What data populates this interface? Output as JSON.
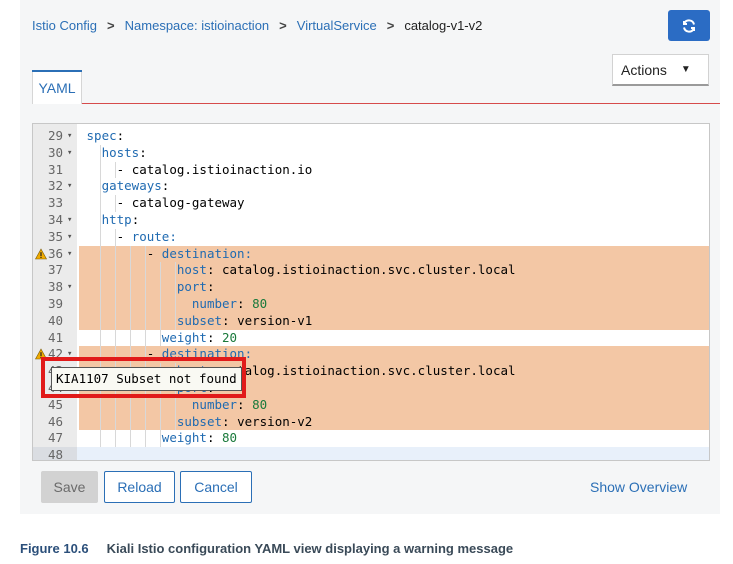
{
  "breadcrumb": {
    "items": [
      "Istio Config",
      "Namespace: istioinaction",
      "VirtualService"
    ],
    "current": "catalog-v1-v2",
    "separator": ">"
  },
  "toolbar": {
    "refresh_icon": "sync-icon",
    "actions_label": "Actions",
    "actions_icon": "caret-down-icon"
  },
  "tabs": [
    {
      "label": "YAML",
      "active": true
    }
  ],
  "editor": {
    "lines": [
      {
        "num": "29",
        "fold": true,
        "warn": false,
        "hl": false,
        "indent": 0,
        "key": "spec",
        "sep": ":",
        "val": "",
        "vtype": "str"
      },
      {
        "num": "30",
        "fold": true,
        "warn": false,
        "hl": false,
        "indent": 1,
        "key": "hosts",
        "sep": ":",
        "val": "",
        "vtype": "str"
      },
      {
        "num": "31",
        "fold": false,
        "warn": false,
        "hl": false,
        "indent": 2,
        "key": "",
        "sep": "- ",
        "val": "catalog.istioinaction.io",
        "vtype": "str"
      },
      {
        "num": "32",
        "fold": true,
        "warn": false,
        "hl": false,
        "indent": 1,
        "key": "gateways",
        "sep": ":",
        "val": "",
        "vtype": "str"
      },
      {
        "num": "33",
        "fold": false,
        "warn": false,
        "hl": false,
        "indent": 2,
        "key": "",
        "sep": "- ",
        "val": "catalog-gateway",
        "vtype": "str"
      },
      {
        "num": "34",
        "fold": true,
        "warn": false,
        "hl": false,
        "indent": 1,
        "key": "http",
        "sep": ":",
        "val": "",
        "vtype": "str"
      },
      {
        "num": "35",
        "fold": true,
        "warn": false,
        "hl": false,
        "indent": 2,
        "key": "",
        "sep": "- ",
        "val": "route:",
        "vtype": "key"
      },
      {
        "num": "36",
        "fold": true,
        "warn": true,
        "hl": true,
        "indent": 4,
        "key": "",
        "sep": "- ",
        "val": "destination:",
        "vtype": "key"
      },
      {
        "num": "37",
        "fold": false,
        "warn": false,
        "hl": true,
        "indent": 6,
        "key": "host",
        "sep": ": ",
        "val": "catalog.istioinaction.svc.cluster.local",
        "vtype": "str"
      },
      {
        "num": "38",
        "fold": true,
        "warn": false,
        "hl": true,
        "indent": 6,
        "key": "port",
        "sep": ":",
        "val": "",
        "vtype": "str"
      },
      {
        "num": "39",
        "fold": false,
        "warn": false,
        "hl": true,
        "indent": 7,
        "key": "number",
        "sep": ": ",
        "val": "80",
        "vtype": "num"
      },
      {
        "num": "40",
        "fold": false,
        "warn": false,
        "hl": true,
        "indent": 6,
        "key": "subset",
        "sep": ": ",
        "val": "version-v1",
        "vtype": "str"
      },
      {
        "num": "41",
        "fold": false,
        "warn": false,
        "hl": false,
        "indent": 5,
        "key": "weight",
        "sep": ": ",
        "val": "20",
        "vtype": "num"
      },
      {
        "num": "42",
        "fold": true,
        "warn": true,
        "hl": true,
        "indent": 4,
        "key": "",
        "sep": "- ",
        "val": "destination:",
        "vtype": "key"
      },
      {
        "num": "43",
        "fold": false,
        "warn": false,
        "hl": true,
        "indent": 6,
        "key": "host",
        "sep": ": ",
        "val": "catalog.istioinaction.svc.cluster.local",
        "vtype": "str"
      },
      {
        "num": "44",
        "fold": false,
        "warn": false,
        "hl": true,
        "indent": 6,
        "key": "port",
        "sep": ":",
        "val": "",
        "vtype": "str"
      },
      {
        "num": "45",
        "fold": false,
        "warn": false,
        "hl": true,
        "indent": 7,
        "key": "number",
        "sep": ": ",
        "val": "80",
        "vtype": "num"
      },
      {
        "num": "46",
        "fold": false,
        "warn": false,
        "hl": true,
        "indent": 6,
        "key": "subset",
        "sep": ": ",
        "val": "version-v2",
        "vtype": "str"
      },
      {
        "num": "47",
        "fold": false,
        "warn": false,
        "hl": false,
        "indent": 5,
        "key": "weight",
        "sep": ": ",
        "val": "80",
        "vtype": "num"
      },
      {
        "num": "48",
        "fold": false,
        "warn": false,
        "hl": false,
        "indent": 0,
        "key": "",
        "sep": "",
        "val": "",
        "vtype": "str",
        "active": true
      }
    ],
    "tooltip": "KIA1107 Subset not found",
    "warn_icon": "warning-triangle-icon",
    "fold_icon": "fold-caret-icon"
  },
  "buttons": {
    "save": "Save",
    "reload": "Reload",
    "cancel": "Cancel",
    "show_overview": "Show Overview"
  },
  "caption": {
    "figure": "Figure 10.6",
    "text": "Kiali Istio configuration YAML view displaying a warning message"
  },
  "colors": {
    "accent": "#2b6fb6",
    "highlight": "#f3c7a5",
    "annotation": "#e11a1a",
    "warning": "#f0ab00"
  }
}
